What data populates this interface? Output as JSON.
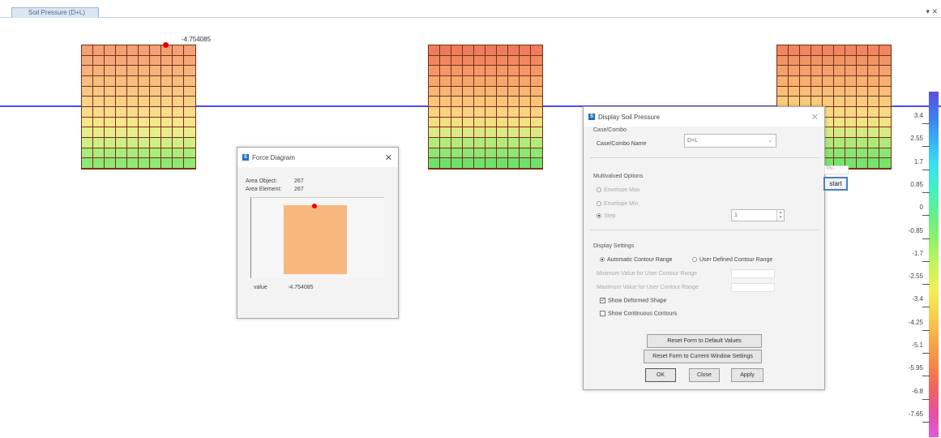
{
  "tab": {
    "title": "Soil Pressure (D+L)",
    "controls": "▾ ✕"
  },
  "point_annotation": "-4.754085",
  "mesh_colors": {
    "left": [
      "#f2a174",
      "#f3aa78",
      "#f5b47c",
      "#f6be80",
      "#f7c884",
      "#f9d288",
      "#f9dc8c",
      "#f6e68e",
      "#e8ee8c",
      "#cdef86",
      "#a8ec7c",
      "#8ee874"
    ],
    "middle": [
      "#ee7c5c",
      "#f08962",
      "#f39868",
      "#f5a76e",
      "#f7b674",
      "#f8c47a",
      "#f9d381",
      "#f3e084",
      "#dce984",
      "#b3ea7e",
      "#8ee674",
      "#6fe26c"
    ],
    "right": [
      "#ef8660",
      "#f19466",
      "#f3a26c",
      "#f5b072",
      "#f7be78",
      "#f8cc7e",
      "#f9da84",
      "#f0e486",
      "#d6eb84",
      "#aee97c",
      "#8ae674",
      "#74e46e"
    ]
  },
  "force_diagram": {
    "title": "Force Diagram",
    "area_object_label": "Area Object:",
    "area_object_value": "267",
    "area_element_label": "Area Element:",
    "area_element_value": "267",
    "value_label": "value",
    "value": "-4.754085",
    "fill": "#f8b77c"
  },
  "soil_dialog": {
    "title": "Display Soil Pressure",
    "case_group": "Case/Combo",
    "case_name_label": "Case/Combo Name",
    "case_name_value": "D+L",
    "multi_group": "Multivalued Options",
    "envelope_max": "Envelope Max",
    "envelope_min": "Envelope Min",
    "step": "Step",
    "step_value": "1",
    "display_group": "Display Settings",
    "auto_contour": "Automatic Contour Range",
    "user_contour": "User Defined Contour Range",
    "min_label": "Minimum Value for User Contour Range",
    "max_label": "Maximum Value for User Contour Range",
    "show_deformed": "Show Deformed Shape",
    "show_continuous": "Show Continuous Contours",
    "reset_default": "Reset Form to Default Values",
    "reset_current": "Reset Form to Current Window Settings",
    "ok": "OK",
    "close": "Close",
    "apply": "Apply"
  },
  "start_popup": {
    "label": "start",
    "hint": "Pu.."
  },
  "legend": {
    "values": [
      "3.4",
      "2.55",
      "1.7",
      "0.85",
      "0",
      "-0.85",
      "-1.7",
      "-2.55",
      "-3.4",
      "-4.25",
      "-5.1",
      "-5.95",
      "-6.8",
      "-7.65"
    ],
    "colors": [
      "#5a4fe0",
      "#3d7df0",
      "#38b2f5",
      "#3fe0f0",
      "#44f0c0",
      "#66f08a",
      "#8ef26a",
      "#c4f35c",
      "#f2f055",
      "#f7d24e",
      "#f7aa4a",
      "#f48a48",
      "#f0645a",
      "#e552a0",
      "#e05ad8"
    ]
  }
}
